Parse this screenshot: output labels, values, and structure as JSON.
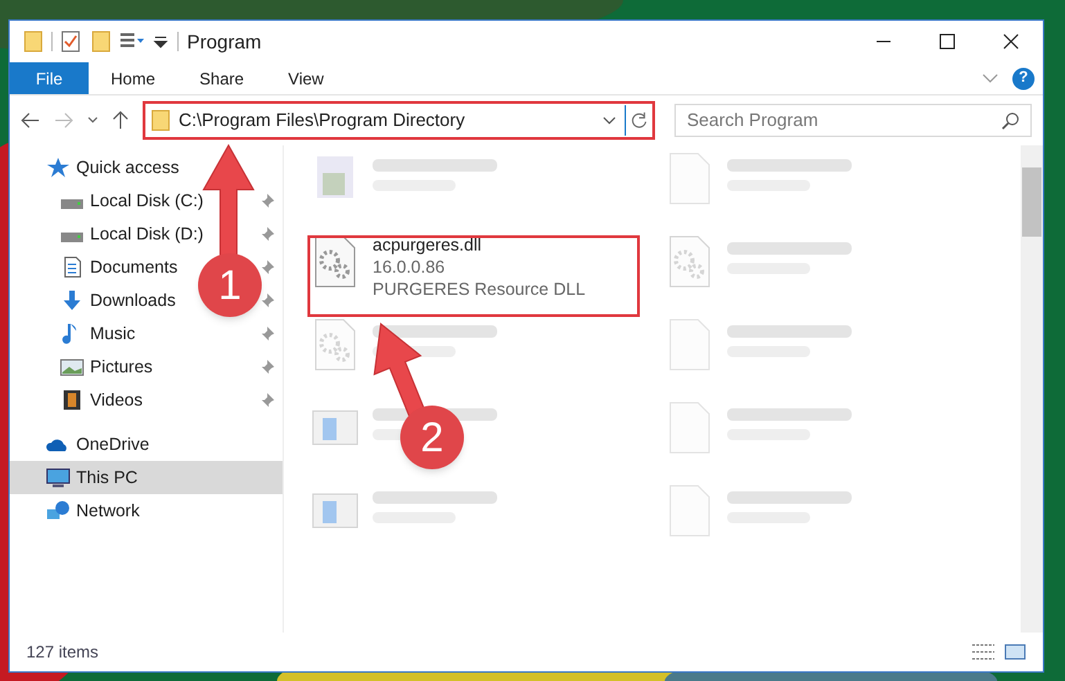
{
  "window": {
    "title": "Program"
  },
  "ribbon_tabs": [
    {
      "label": "File",
      "selected": true
    },
    {
      "label": "Home",
      "selected": false
    },
    {
      "label": "Share",
      "selected": false
    },
    {
      "label": "View",
      "selected": false
    }
  ],
  "help_button": "?",
  "address_bar": {
    "path": "C:\\Program Files\\Program Directory"
  },
  "search": {
    "placeholder": "Search Program"
  },
  "sidebar": {
    "items": [
      {
        "label": "Quick access",
        "kind": "star",
        "selected": false,
        "children": [
          {
            "label": "Local Disk (C:)",
            "kind": "drive",
            "pinned": true,
            "selected": false
          },
          {
            "label": "Local Disk (D:)",
            "kind": "drive",
            "pinned": true,
            "selected": false
          },
          {
            "label": "Documents",
            "kind": "document",
            "pinned": true,
            "selected": false
          },
          {
            "label": "Downloads",
            "kind": "download",
            "pinned": true,
            "selected": false
          },
          {
            "label": "Music",
            "kind": "music",
            "pinned": true,
            "selected": false
          },
          {
            "label": "Pictures",
            "kind": "pictures",
            "pinned": true,
            "selected": false
          },
          {
            "label": "Videos",
            "kind": "video",
            "pinned": true,
            "selected": false
          }
        ]
      },
      {
        "label": "OneDrive",
        "kind": "cloud",
        "selected": false
      },
      {
        "label": "This PC",
        "kind": "pc",
        "selected": true
      },
      {
        "label": "Network",
        "kind": "network",
        "selected": false
      }
    ]
  },
  "files": [
    {
      "kind": "app",
      "blurred": true
    },
    {
      "kind": "blank",
      "blurred": true
    },
    {
      "kind": "gear",
      "blurred": false,
      "name": "acpurgeres.dll",
      "lines": [
        "16.0.0.86",
        "PURGERES Resource DLL"
      ]
    },
    {
      "kind": "gear",
      "blurred": true
    },
    {
      "kind": "gear",
      "blurred": true
    },
    {
      "kind": "blank",
      "blurred": true
    },
    {
      "kind": "window",
      "blurred": true
    },
    {
      "kind": "blank",
      "blurred": true
    },
    {
      "kind": "window",
      "blurred": true
    },
    {
      "kind": "blank",
      "blurred": true
    }
  ],
  "status_bar": {
    "count": "127 items"
  },
  "callouts": [
    {
      "number": "1"
    },
    {
      "number": "2"
    }
  ]
}
